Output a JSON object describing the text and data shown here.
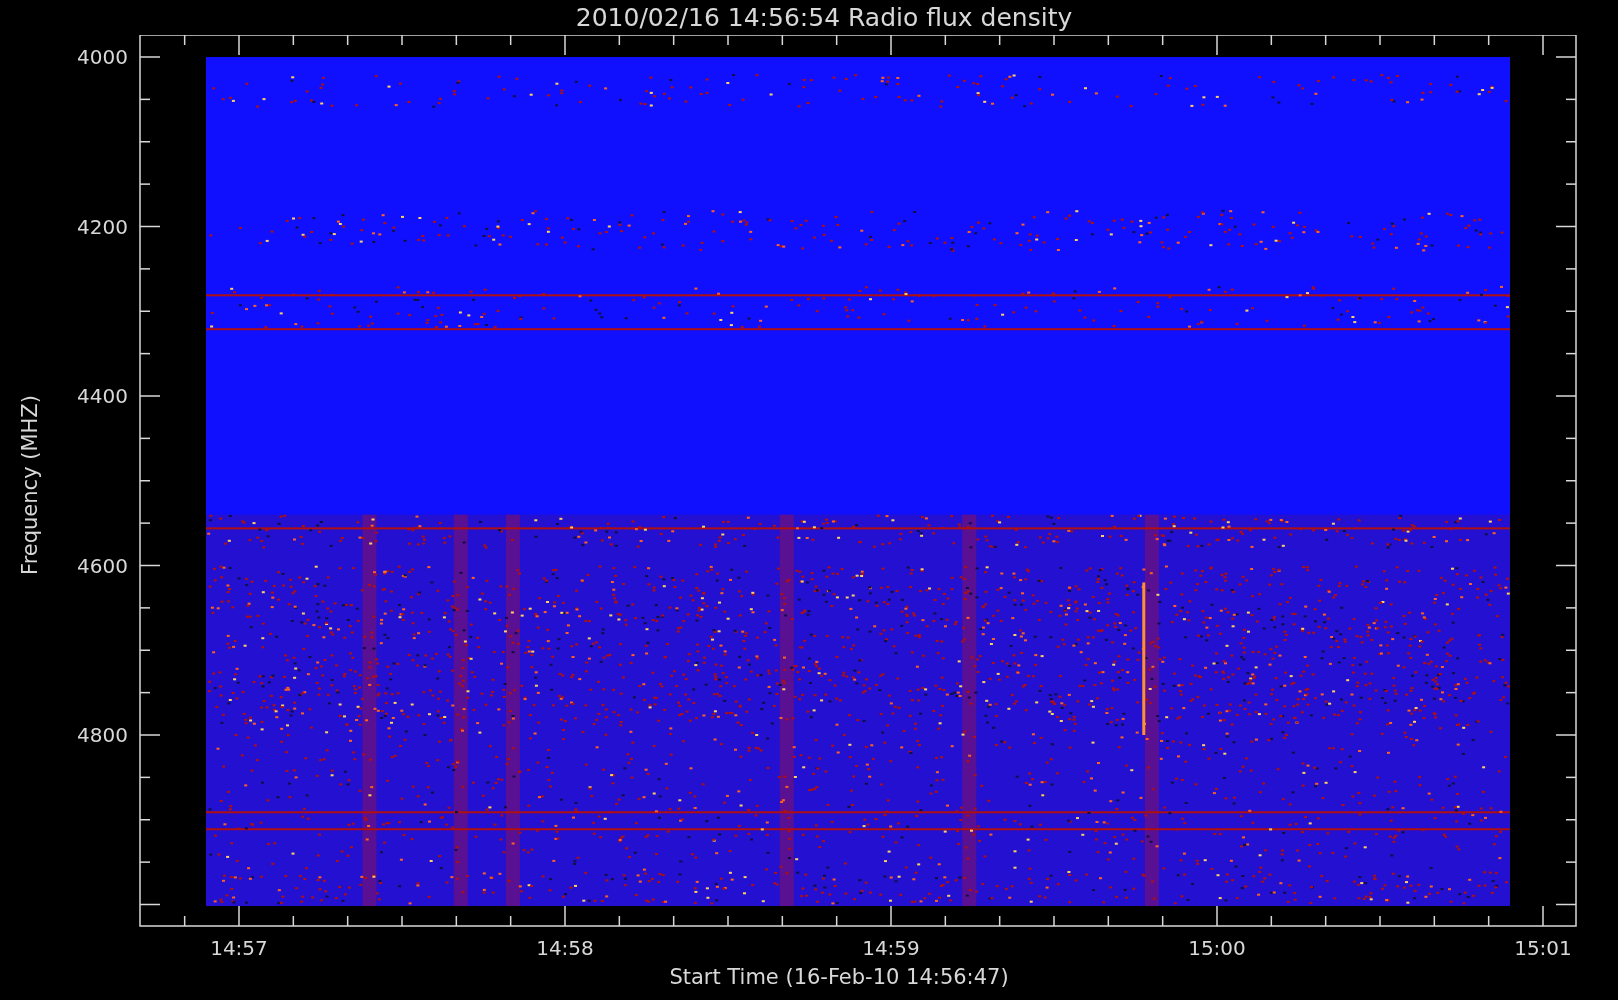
{
  "plot": {
    "title": "2010/02/16 14:56:54 Radio flux density",
    "y_axis_label": "Frequency (MHZ)",
    "x_axis_label": "Start Time (16-Feb-10 14:56:47)",
    "y_tick_labels": [
      "4000",
      "4200",
      "4400",
      "4600",
      "4800"
    ],
    "x_tick_labels": [
      "14:57",
      "14:58",
      "14:59",
      "15:00",
      "15:01"
    ]
  }
}
